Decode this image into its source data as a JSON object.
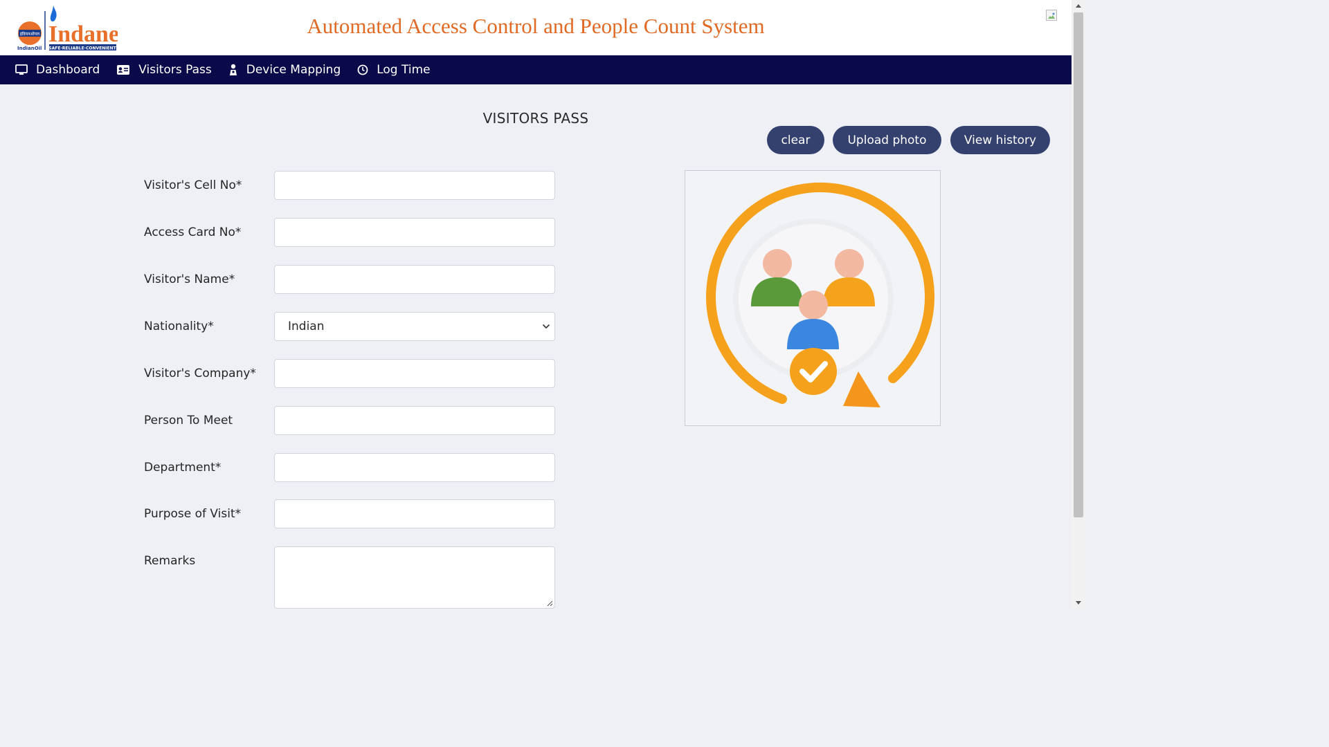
{
  "header": {
    "app_title": "Automated Access Control and People Count System",
    "logo": {
      "brand": "Indane",
      "tagline": "SAFE·RELIABLE·CONVENIENT",
      "sub_brand": "IndianOil",
      "hindi": "इंडियनऑयल",
      "icon": "indane-flame-logo",
      "colors": {
        "orange": "#e8702a",
        "blue": "#1a3a8a"
      }
    },
    "right_image_icon": "broken-image-icon"
  },
  "nav": {
    "background": "#0a0a4a",
    "items": [
      {
        "label": "Dashboard",
        "icon": "monitor-icon"
      },
      {
        "label": "Visitors Pass",
        "icon": "id-card-icon"
      },
      {
        "label": "Device Mapping",
        "icon": "user-device-icon"
      },
      {
        "label": "Log Time",
        "icon": "clock-icon"
      }
    ]
  },
  "form": {
    "title": "VISITORS PASS",
    "buttons": {
      "clear": "clear",
      "upload_photo": "Upload photo",
      "view_history": "View history",
      "color": "#34406e"
    },
    "fields": [
      {
        "label": "Visitor's Cell No*",
        "value": ""
      },
      {
        "label": "Access Card No*",
        "value": ""
      },
      {
        "label": "Visitor's Name*",
        "value": ""
      },
      {
        "label": "Nationality*",
        "value": "Indian"
      },
      {
        "label": "Visitor's Company*",
        "value": ""
      },
      {
        "label": "Person To Meet",
        "value": ""
      },
      {
        "label": "Department*",
        "value": ""
      },
      {
        "label": "Purpose of Visit*",
        "value": ""
      },
      {
        "label": "Remarks",
        "value": ""
      }
    ]
  },
  "photo_placeholder": {
    "icon": "visitors-group-check-icon",
    "colors": {
      "ring": "#f5a11c",
      "green": "#5a9a3a",
      "orange": "#f5a21c",
      "blue": "#3b87e0",
      "skin": "#f2b8a0"
    }
  }
}
